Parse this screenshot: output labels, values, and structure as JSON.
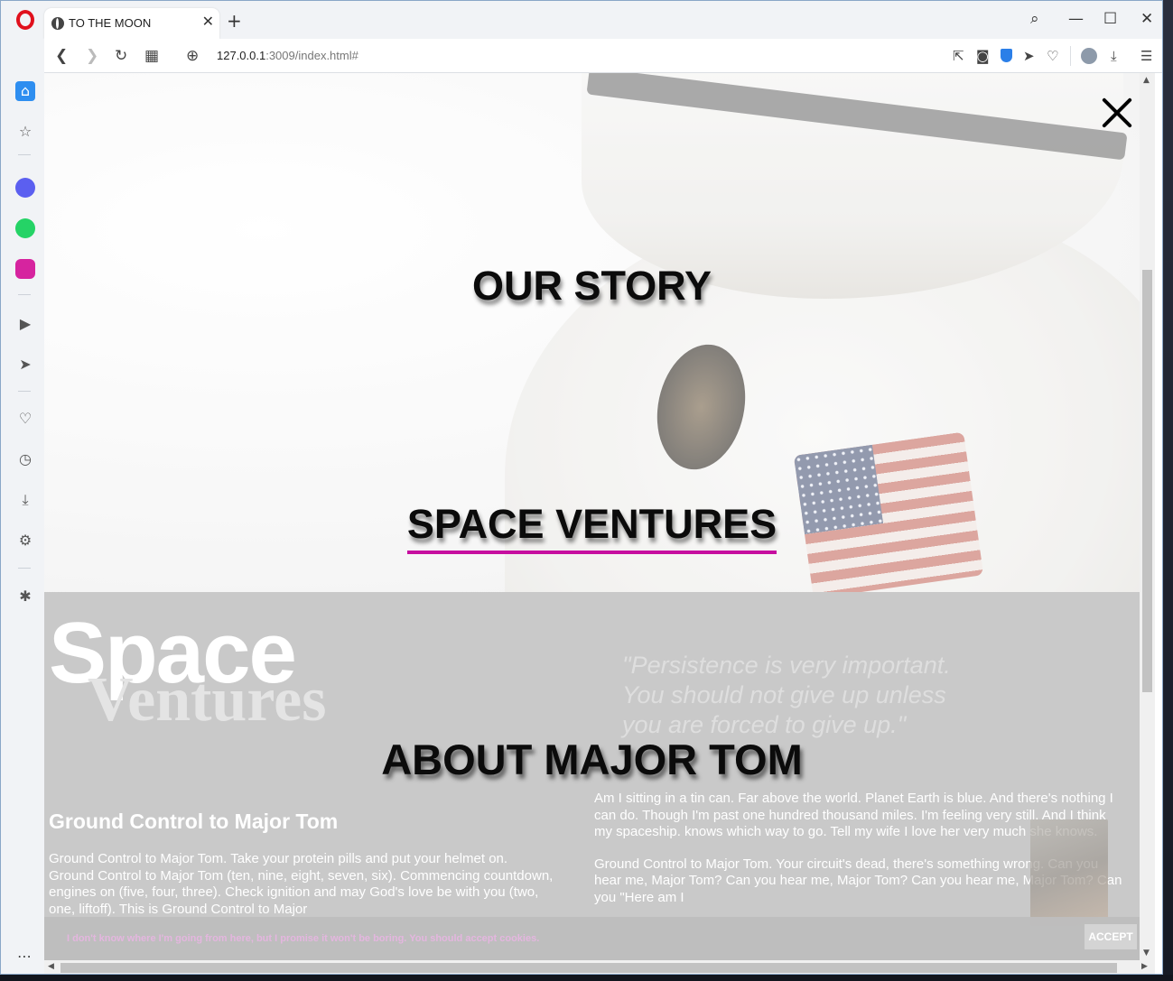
{
  "browser": {
    "tab_title": "TO THE MOON",
    "url_host": "127.0.0.1",
    "url_path": ":3009/index.html#"
  },
  "menu": {
    "items": [
      "OUR STORY",
      "SPACE VENTURES"
    ],
    "active_item": "SPACE VENTURES",
    "active_underline_color": "#c60e9f"
  },
  "section": {
    "logo_line1": "Space",
    "logo_line2": "Ventures",
    "quote_lines": [
      "\"Persistence is very important.",
      "You should not give up unless",
      "you are forced to give up.\""
    ],
    "title": "ABOUT MAJOR TOM",
    "left_heading": "Ground Control to Major Tom",
    "left_body": "Ground Control to Major Tom. Take your protein pills and put your helmet on. Ground Control to Major Tom (ten, nine, eight, seven, six). Commencing countdown, engines on (five, four, three). Check ignition and may God's love be with you (two, one, liftoff). This is Ground Control to Major",
    "right_paragraph_1": "Am I sitting in a tin can. Far above the world. Planet Earth is blue. And there's nothing I can do. Though I'm past one hundred thousand miles. I'm feeling very still. And I think my spaceship. knows which way to go. Tell my wife I love her very much she knows.",
    "right_paragraph_2": "Ground Control to Major Tom. Your circuit's dead, there's something wrong. Can you hear me, Major Tom? Can you hear me, Major Tom? Can you hear me, Major Tom? Can you \"Here am I"
  },
  "cookie": {
    "text": "I don't know where I'm going from here, but I promise it won't be boring. You should accept cookies.",
    "button_label": "ACCEPT"
  },
  "icons": {
    "tab_close": "✕",
    "new_tab": "+",
    "search": "⌕",
    "minimize": "—",
    "maximize": "☐",
    "window_close": "✕",
    "back": "❮",
    "forward": "❯",
    "reload": "↻",
    "tab_grid": "▦",
    "site_info": "⊕",
    "share": "⇱",
    "camera": "◙",
    "send": "➤",
    "heart": "♡",
    "download": "⤓",
    "easy_setup": "☰",
    "home": "⌂",
    "bookmarks": "☆",
    "player": "▶",
    "history": "◷",
    "settings": "⚙",
    "tips": "✱",
    "more": "⋯"
  },
  "colors": {
    "accent_magenta": "#c60e9f",
    "opera_red": "#e0101c",
    "messenger": "#5b5ff0",
    "whatsapp": "#25d366",
    "instagram": "#d6249f",
    "sidebar_home": "#2e8ef0"
  }
}
